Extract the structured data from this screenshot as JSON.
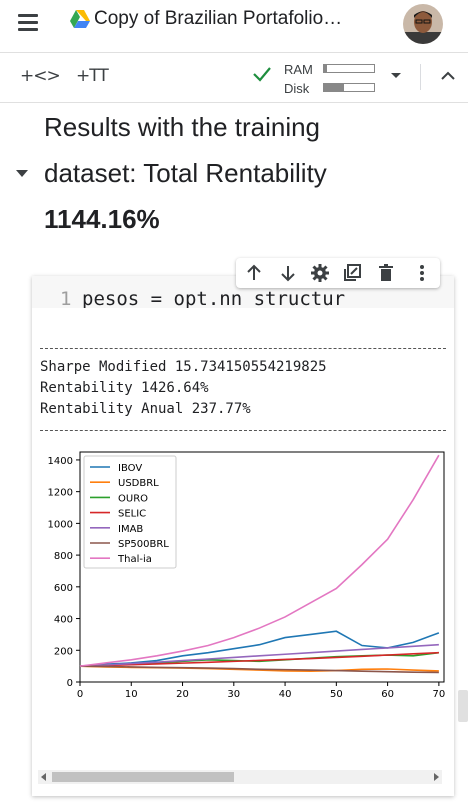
{
  "header": {
    "title": "Copy of Brazilian Portafolio…",
    "menu_icon": "hamburger-menu-icon",
    "drive_icon": "google-drive-icon",
    "avatar": "user-avatar"
  },
  "toolbar": {
    "add_code_label": "+<>",
    "add_text_label": "+TT",
    "ram_label": "RAM",
    "disk_label": "Disk",
    "ram_usage": 0.05,
    "disk_usage": 0.4,
    "status_icon": "check-icon",
    "colors": {
      "check": "#1e8e3e"
    }
  },
  "text_cell": {
    "line1": "Results with the training",
    "line2": "dataset: Total Rentability",
    "line3": "1144.16%"
  },
  "code_cell": {
    "line_number": "1",
    "code": "pesos = opt.nn_structur",
    "toolbar_icons": [
      "arrow-up-icon",
      "arrow-down-icon",
      "gear-icon",
      "mirror-cell-icon",
      "delete-icon",
      "more-vert-icon"
    ]
  },
  "output": {
    "sharpe": "Sharpe Modified 15.734150554219825",
    "rentability": "Rentability 1426.64%",
    "rentability_anual": "Rentability Anual 237.77%"
  },
  "chart_data": {
    "type": "line",
    "x": [
      0,
      5,
      10,
      15,
      20,
      25,
      30,
      35,
      40,
      45,
      50,
      55,
      60,
      65,
      70
    ],
    "xlim": [
      0,
      71
    ],
    "ylim": [
      0,
      1450
    ],
    "xticks": [
      "0",
      "10",
      "20",
      "30",
      "40",
      "50",
      "60",
      "70"
    ],
    "yticks": [
      "0",
      "200",
      "400",
      "600",
      "800",
      "1000",
      "1200",
      "1400"
    ],
    "legend": "top-left",
    "series": [
      {
        "name": "IBOV",
        "color": "#1f77b4",
        "values": [
          100,
          112,
          120,
          135,
          165,
          185,
          210,
          235,
          280,
          300,
          320,
          230,
          215,
          250,
          310
        ]
      },
      {
        "name": "USDBRL",
        "color": "#ff7f0e",
        "values": [
          100,
          95,
          92,
          90,
          88,
          85,
          80,
          75,
          70,
          68,
          72,
          80,
          82,
          75,
          70
        ]
      },
      {
        "name": "OURO",
        "color": "#2ca02c",
        "values": [
          100,
          108,
          110,
          120,
          130,
          140,
          135,
          130,
          140,
          150,
          160,
          165,
          170,
          165,
          185
        ]
      },
      {
        "name": "SELIC",
        "color": "#d62728",
        "values": [
          100,
          104,
          109,
          114,
          119,
          124,
          130,
          136,
          142,
          148,
          155,
          162,
          170,
          178,
          185
        ]
      },
      {
        "name": "IMAB",
        "color": "#9467bd",
        "values": [
          100,
          108,
          116,
          125,
          135,
          145,
          155,
          165,
          175,
          185,
          195,
          205,
          215,
          225,
          235
        ]
      },
      {
        "name": "SP500BRL",
        "color": "#8c564b",
        "values": [
          100,
          98,
          95,
          92,
          90,
          88,
          85,
          80,
          78,
          75,
          72,
          68,
          65,
          62,
          60
        ]
      },
      {
        "name": "Thal-ia",
        "color": "#e377c2",
        "values": [
          100,
          120,
          140,
          165,
          195,
          230,
          280,
          340,
          410,
          500,
          590,
          740,
          900,
          1150,
          1430
        ]
      }
    ]
  }
}
